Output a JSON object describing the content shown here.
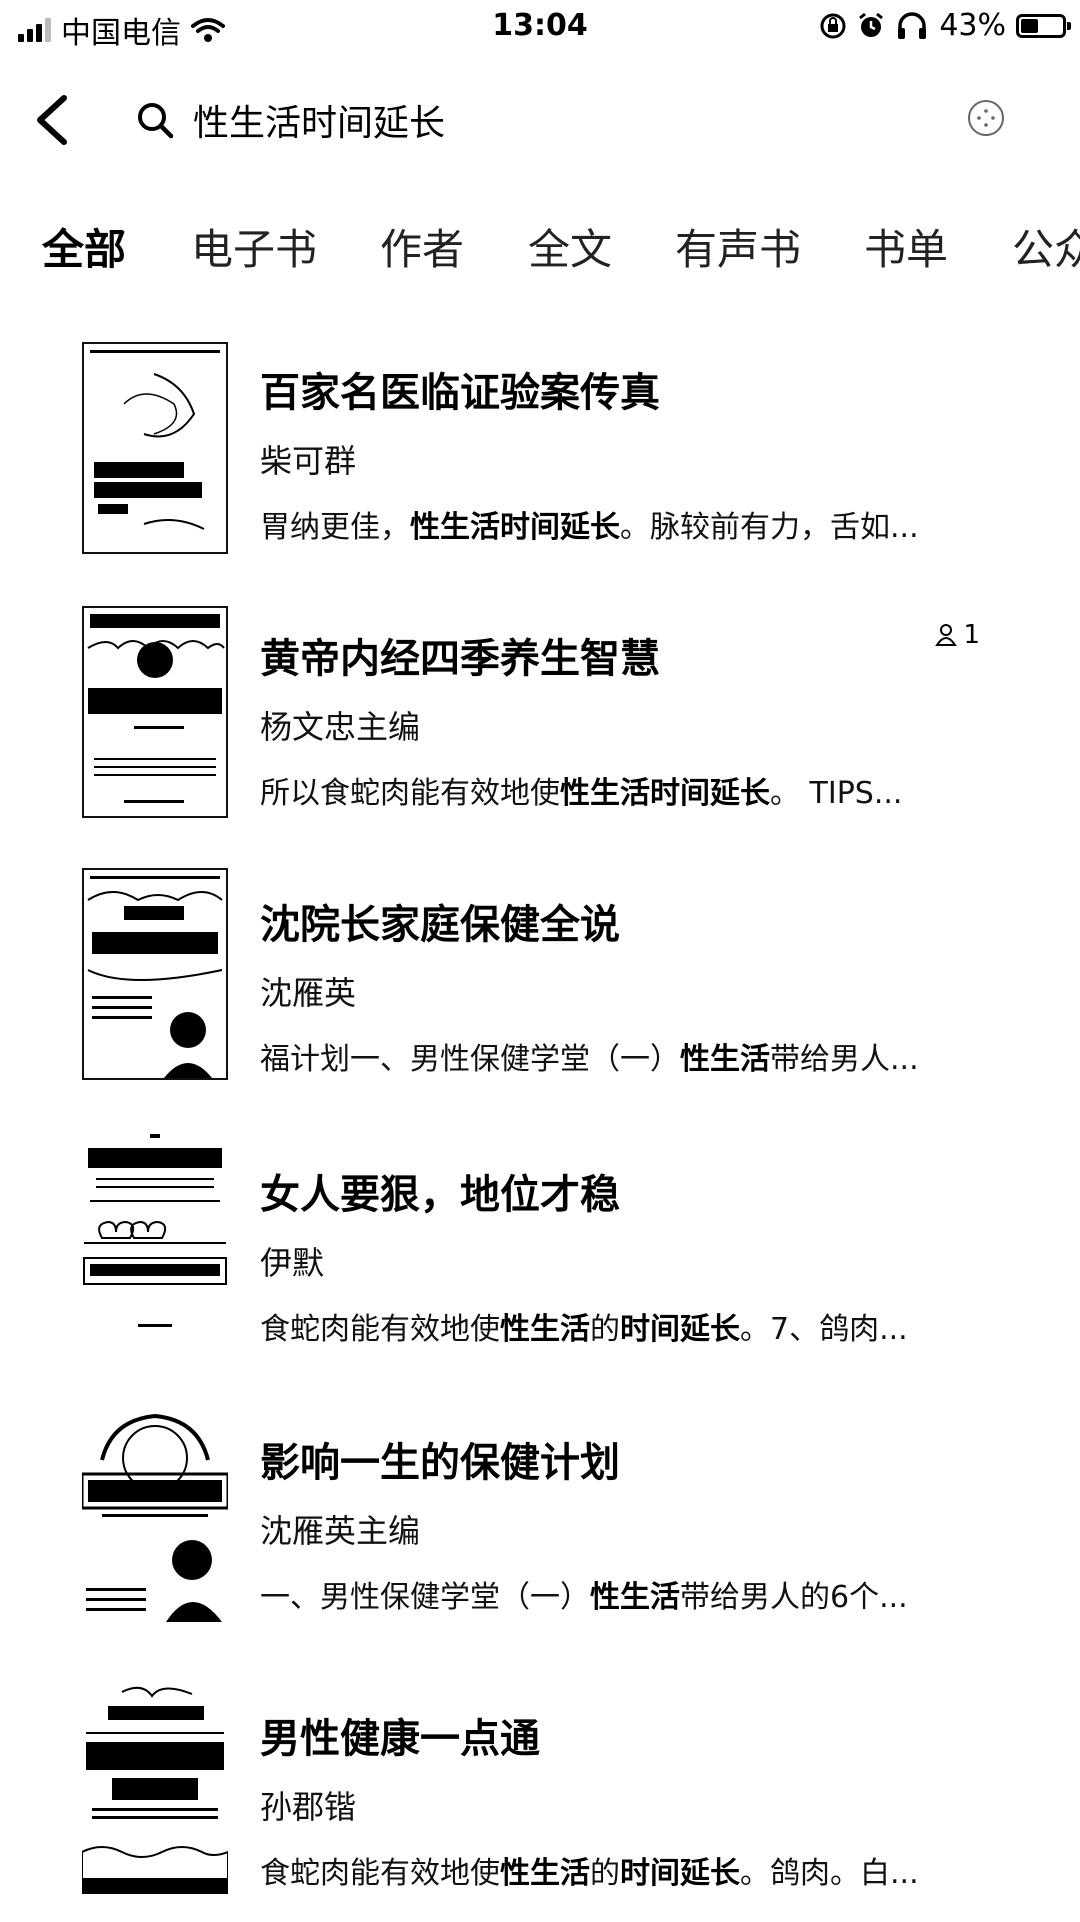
{
  "status_bar": {
    "carrier": "中国电信",
    "time": "13:04",
    "battery_percent": "43%",
    "battery_level": 0.43
  },
  "search": {
    "query": "性生活时间延长"
  },
  "tabs": [
    {
      "label": "全部",
      "active": true
    },
    {
      "label": "电子书",
      "active": false
    },
    {
      "label": "作者",
      "active": false
    },
    {
      "label": "全文",
      "active": false
    },
    {
      "label": "有声书",
      "active": false
    },
    {
      "label": "书单",
      "active": false
    },
    {
      "label": "公众",
      "active": false
    }
  ],
  "results": [
    {
      "title": "百家名医临证验案传真",
      "author": "柴可群",
      "snippet_pre": "胃纳更佳，",
      "snippet_hl": "性生活时间延长",
      "snippet_post": "。脉较前有力，舌如...",
      "cover_title": "百家名医临证验案传真"
    },
    {
      "title": "黄帝内经四季养生智慧",
      "author": "杨文忠主编",
      "snippet_pre": "所以食蛇肉能有效地使",
      "snippet_hl": "性生活时间延长",
      "snippet_post": "。 TIPS...",
      "reader_count": "1",
      "cover_title": "四季养生智慧"
    },
    {
      "title": "沈院长家庭保健全说",
      "author": "沈雁英",
      "snippet_pre": "福计划一、男性保健学堂（一）",
      "snippet_hl": "性生活",
      "snippet_post": "带给男人...",
      "cover_title": "沈院长家庭保健全说"
    },
    {
      "title": "女人要狠，地位才稳",
      "author": "伊默",
      "snippet_pre": "食蛇肉能有效地使",
      "snippet_hl": "性生活",
      "snippet_mid": "的",
      "snippet_hl2": "时间延长",
      "snippet_post": "。7、鸽肉...",
      "cover_title": "女人要狠 地位才稳"
    },
    {
      "title": "影响一生的保健计划",
      "author": "沈雁英主编",
      "snippet_pre": "一、男性保健学堂（一）",
      "snippet_hl": "性生活",
      "snippet_post": "带给男人的6个...",
      "cover_title": "影响一生的保健计划"
    },
    {
      "title": "男性健康一点通",
      "author": "孙郡锴",
      "snippet_pre": "食蛇肉能有效地使",
      "snippet_hl": "性生活",
      "snippet_mid": "的",
      "snippet_hl2": "时间延长",
      "snippet_post": "。鸽肉。白...",
      "cover_title": "男性健康一点通"
    }
  ]
}
